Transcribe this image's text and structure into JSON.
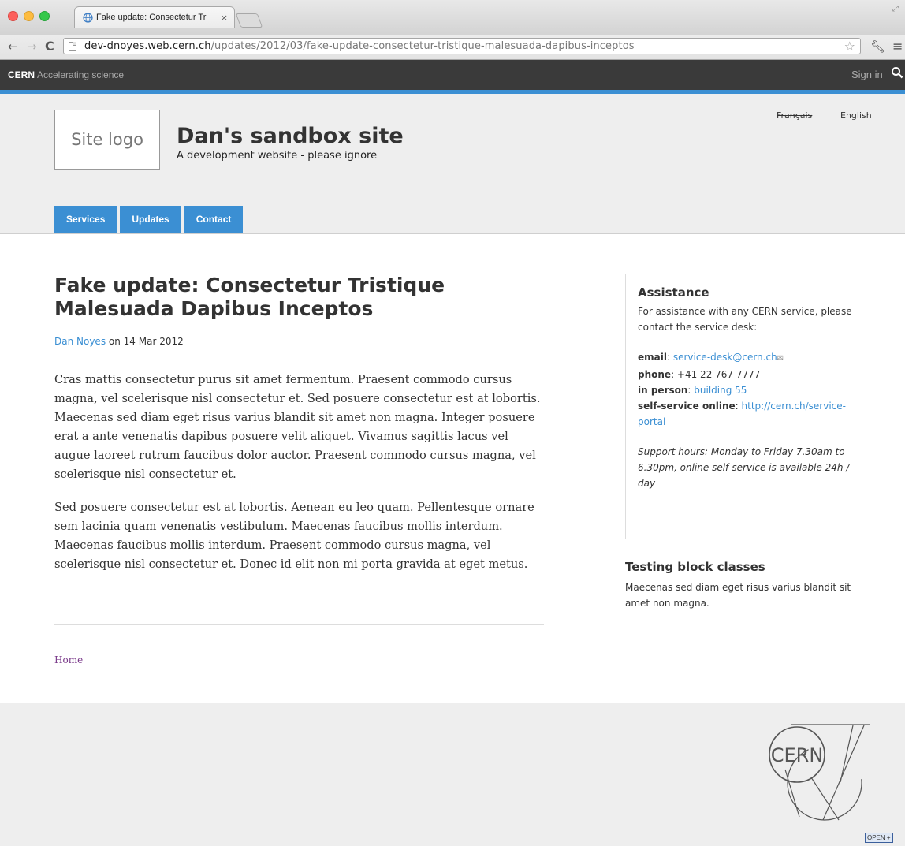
{
  "browser": {
    "tab_title": "Fake update: Consectetur Tr",
    "tab_close": "×",
    "url_host": "dev-dnoyes.web.cern.ch",
    "url_path": "/updates/2012/03/fake-update-consectetur-tristique-malesuada-dapibus-inceptos",
    "icons": [
      "back-arrow-icon",
      "forward-arrow-icon",
      "reload-icon",
      "page-icon",
      "star-icon",
      "wrench-icon",
      "menu-icon"
    ]
  },
  "cern_toolbar": {
    "brand": "CERN",
    "tagline": "Accelerating science",
    "signin": "Sign in"
  },
  "header": {
    "logo_text": "Site logo",
    "site_name": "Dan's sandbox site",
    "slogan": "A development website - please ignore",
    "lang_fr": "Français",
    "lang_en": "English",
    "menu": [
      "Services",
      "Updates",
      "Contact"
    ]
  },
  "article": {
    "title": "Fake update: Consectetur Tristique Malesuada Dapibus Inceptos",
    "author": "Dan Noyes",
    "date_text": " on 14 Mar 2012",
    "paragraphs": [
      "Cras mattis consectetur purus sit amet fermentum. Praesent commodo cursus magna, vel scelerisque nisl consectetur et. Sed posuere consectetur est at lobortis. Maecenas sed diam eget risus varius blandit sit amet non magna. Integer posuere erat a ante venenatis dapibus posuere velit aliquet. Vivamus sagittis lacus vel augue laoreet rutrum faucibus dolor auctor. Praesent commodo cursus magna, vel scelerisque nisl consectetur et.",
      "Sed posuere consectetur est at lobortis. Aenean eu leo quam. Pellentesque ornare sem lacinia quam venenatis vestibulum. Maecenas faucibus mollis interdum. Maecenas faucibus mollis interdum. Praesent commodo cursus magna, vel scelerisque nisl consectetur et. Donec id elit non mi porta gravida at eget metus."
    ],
    "breadcrumb_home": "Home"
  },
  "sidebar": {
    "assist_title": "Assistance",
    "assist_intro": "For assistance with any CERN service, please contact the service desk:",
    "email_label": "email",
    "email_value": "service-desk@cern.ch",
    "phone_label": "phone",
    "phone_value": ": +41 22 767 7777",
    "person_label": "in person",
    "person_value": "building 55",
    "online_label": "self-service online",
    "online_value": "http://cern.ch/service-portal",
    "sep": ": ",
    "hours": "Support hours: Monday to Friday 7.30am to 6.30pm, online self-service is available 24h / day",
    "testing_title": "Testing block classes",
    "testing_text": "Maecenas sed diam eget risus varius blandit sit amet non magna."
  },
  "footer": {
    "logo_text": "CERN",
    "badge": "OPEN +"
  },
  "colors": {
    "accent": "#3b8fd3",
    "toolbar": "#3a3a3a",
    "visited_link": "#7a3a8a"
  }
}
